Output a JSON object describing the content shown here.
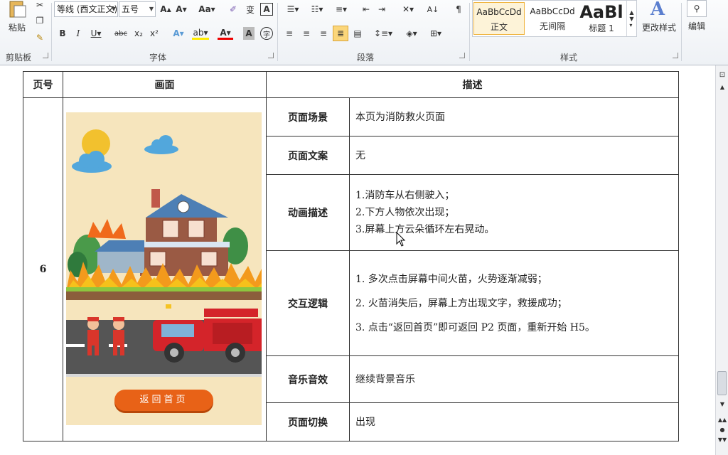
{
  "ribbon": {
    "paste_label": "粘贴",
    "clipboard_label": "剪贴板",
    "font_group_label": "字体",
    "paragraph_group_label": "段落",
    "styles_group_label": "样式",
    "font_name": "等线 (西文正文)",
    "font_size": "五号",
    "style_sample_1": "AaBbCcDd",
    "style_sample_2": "AaBbCcDd",
    "style_sample_3": "AaBl",
    "style_name_1": "正文",
    "style_name_2": "无间隔",
    "style_name_3": "标题 1",
    "change_styles_label": "更改样式",
    "edit_label": "编辑"
  },
  "table": {
    "headers": [
      "页号",
      "画面",
      "描述"
    ],
    "page_number": "6",
    "rows": [
      {
        "label": "页面场景",
        "lines": [
          "本页为消防救火页面"
        ]
      },
      {
        "label": "页面文案",
        "lines": [
          "无"
        ]
      },
      {
        "label": "动画描述",
        "lines": [
          "1.消防车从右侧驶入；",
          "2.下方人物依次出现；",
          "3.屏幕上方云朵循环左右晃动。"
        ]
      },
      {
        "label": "交互逻辑",
        "lines": [
          "1.  多次点击屏幕中间火苗，火势逐渐减弱；",
          "2.  火苗消失后，屏幕上方出现文字，救援成功；",
          "3.  点击“返回首页”即可返回 P2 页面，重新开始 H5。"
        ]
      },
      {
        "label": "音乐音效",
        "lines": [
          "继续背景音乐"
        ]
      },
      {
        "label": "页面切换",
        "lines": [
          "出现"
        ]
      }
    ]
  },
  "scene": {
    "back_button": "返回首页"
  },
  "colors": {
    "accent_button": "#e86217",
    "scene_bg": "#f6e5bd"
  }
}
